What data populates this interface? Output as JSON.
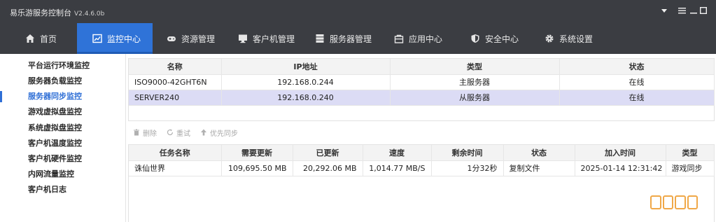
{
  "titlebar": {
    "title": "易乐游服务控制台",
    "version": "V2.4.6.0b"
  },
  "nav": {
    "items": [
      {
        "label": "首页",
        "icon": "home-icon"
      },
      {
        "label": "监控中心",
        "icon": "monitor-chart-icon"
      },
      {
        "label": "资源管理",
        "icon": "gamepad-icon"
      },
      {
        "label": "客户机管理",
        "icon": "desktop-icon"
      },
      {
        "label": "服务器管理",
        "icon": "server-icon"
      },
      {
        "label": "应用中心",
        "icon": "bag-icon"
      },
      {
        "label": "安全中心",
        "icon": "shield-icon"
      },
      {
        "label": "系统设置",
        "icon": "gear-icon"
      }
    ],
    "active_index": 1
  },
  "sidebar": {
    "items": [
      {
        "label": "平台运行环境监控"
      },
      {
        "label": "服务器负载监控"
      },
      {
        "label": "服务器同步监控"
      },
      {
        "label": "游戏虚拟盘监控"
      },
      {
        "label": "系统虚拟盘监控"
      },
      {
        "label": "客户机温度监控"
      },
      {
        "label": "客户机硬件监控"
      },
      {
        "label": "内网流量监控"
      },
      {
        "label": "客户机日志"
      }
    ],
    "active_index": 2
  },
  "servers": {
    "columns": [
      "名称",
      "IP地址",
      "类型",
      "状态"
    ],
    "rows": [
      {
        "name": "ISO9000-42GHT6N",
        "ip": "192.168.0.244",
        "type": "主服务器",
        "status": "在线"
      },
      {
        "name": "SERVER240",
        "ip": "192.168.0.240",
        "type": "从服务器",
        "status": "在线"
      }
    ],
    "selected_index": 1
  },
  "toolbar": {
    "delete_label": "删除",
    "retry_label": "重试",
    "priority_label": "优先同步"
  },
  "tasks": {
    "columns": [
      "任务名称",
      "需要更新",
      "已更新",
      "速度",
      "剩余时间",
      "状态",
      "加入时间",
      "类型"
    ],
    "rows": [
      {
        "name": "诛仙世界",
        "need": "109,695.50 MB",
        "done": "20,292.06 MB",
        "speed": "1,014.77 MB/S",
        "remaining": "1分32秒",
        "status": "复制文件",
        "added": "2025-01-14 12:31:42",
        "type": "游戏同步"
      }
    ]
  },
  "colors": {
    "accent": "#2f73d8",
    "titlebar": "#3b3d42",
    "selected_row": "#dcdcf5",
    "watermark": "#f0a848"
  }
}
